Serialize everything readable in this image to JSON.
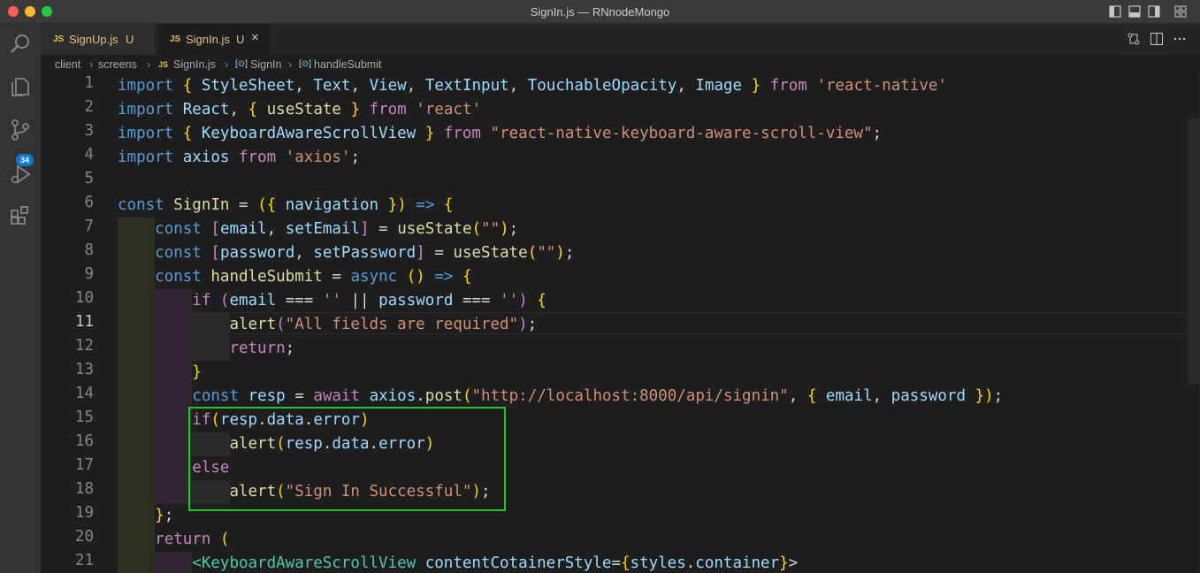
{
  "window": {
    "title": "SignIn.js — RNnodeMongo"
  },
  "colors": {
    "close": "#ff5f57",
    "minimize": "#febc2e",
    "maximize": "#28c840",
    "badge": "#0e7ad3",
    "highlight_box": "#27c227"
  },
  "activity_bar": {
    "items": [
      "explorer-icon",
      "files-icon",
      "source-control-icon",
      "run-debug-icon",
      "extensions-icon",
      "search-icon"
    ],
    "source_control_badge": "34"
  },
  "tabs": [
    {
      "icon": "JS",
      "label": "SignUp.js",
      "status": "U"
    },
    {
      "icon": "JS",
      "label": "SignIn.js",
      "status": "U",
      "active": true
    }
  ],
  "breadcrumb": {
    "parts": [
      "client",
      "screens",
      "SignIn.js",
      "SignIn",
      "handleSubmit"
    ],
    "file_icon": "JS"
  },
  "editor": {
    "current_line": 11,
    "line_numbers": [
      "1",
      "2",
      "3",
      "4",
      "5",
      "6",
      "7",
      "8",
      "9",
      "10",
      "11",
      "12",
      "13",
      "14",
      "15",
      "16",
      "17",
      "18",
      "19",
      "20",
      "21"
    ],
    "lines": [
      "import { StyleSheet, Text, View, TextInput, TouchableOpacity, Image } from 'react-native'",
      "import React, { useState } from 'react'",
      "import { KeyboardAwareScrollView } from \"react-native-keyboard-aware-scroll-view\";",
      "import axios from 'axios';",
      "",
      "const SignIn = ({ navigation }) => {",
      "    const [email, setEmail] = useState(\"\");",
      "    const [password, setPassword] = useState(\"\");",
      "    const handleSubmit = async () => {",
      "        if (email === '' || password === '') {",
      "            alert(\"All fields are required\");",
      "            return;",
      "        }",
      "        const resp = await axios.post(\"http://localhost:8000/api/signin\", { email, password });",
      "        if(resp.data.error)",
      "            alert(resp.data.error)",
      "        else",
      "            alert(\"Sign In Successful\");",
      "    };",
      "    return (",
      "        <KeyboardAwareScrollView contentCotainerStyle={styles.container}>"
    ]
  }
}
